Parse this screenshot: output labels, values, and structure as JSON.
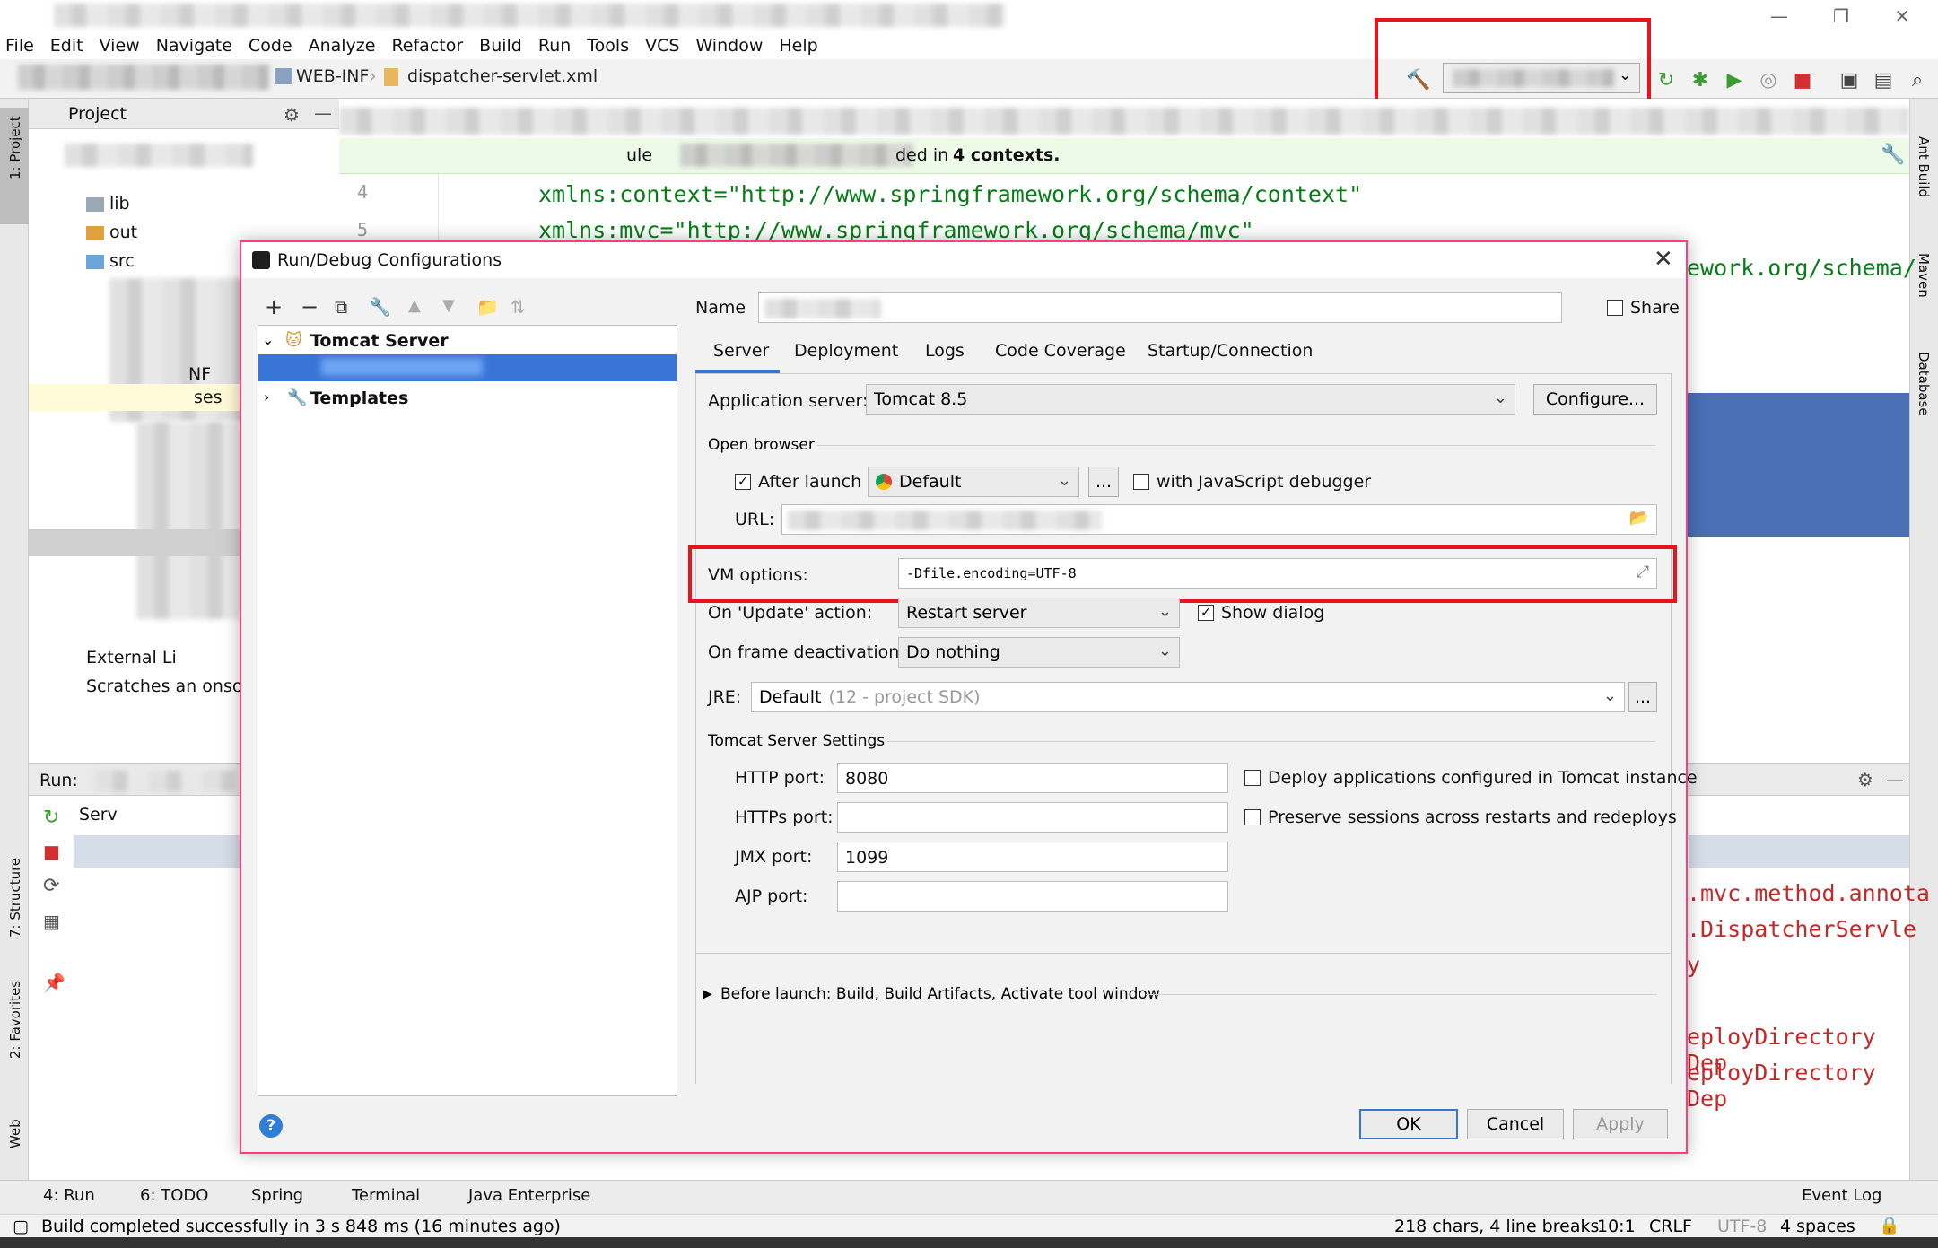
{
  "menu": [
    "File",
    "Edit",
    "View",
    "Navigate",
    "Code",
    "Analyze",
    "Refactor",
    "Build",
    "Run",
    "Tools",
    "VCS",
    "Window",
    "Help"
  ],
  "breadcrumb": {
    "folder": "WEB-INF",
    "file": "dispatcher-servlet.xml"
  },
  "project": {
    "header": "Project",
    "tree": [
      "lib",
      "out",
      "src",
      "NF",
      "ses",
      "External Li",
      "Scratches an onso"
    ]
  },
  "editor": {
    "banner_suffix": "ded in",
    "banner_bold": "4 contexts.",
    "banner_prefix": "ule",
    "line4_num": "4",
    "line5_num": "5",
    "line4": "xmlns:context=\"http://www.springframework.org/schema/context\"",
    "line5": "xmlns:mvc=\"http://www.springframework.org/schema/mvc\"",
    "line6_tail": "ework.org/schema/",
    "right_lines": [
      ".mvc.method.annota",
      ".DispatcherServle",
      "y",
      "eployDirectory Dep",
      "eployDirectory Dep"
    ]
  },
  "run_panel": {
    "label": "Run:",
    "item": "Serv"
  },
  "left_strip": [
    "1: Project",
    "7: Structure",
    "2: Favorites",
    "Web"
  ],
  "right_strip": [
    "Ant Build",
    "Maven",
    "Database"
  ],
  "bottom_tabs": [
    "4: Run",
    "6: TODO",
    "Spring",
    "Terminal",
    "Java Enterprise",
    "Event Log"
  ],
  "status": {
    "message": "Build completed successfully in 3 s 848 ms (16 minutes ago)",
    "chars": "218 chars, 4 line breaks",
    "pos": "10:1",
    "line_sep": "CRLF",
    "encoding": "UTF-8",
    "indent": "4 spaces"
  },
  "dialog": {
    "title": "Run/Debug Configurations",
    "tree_root": "Tomcat Server",
    "tree_templates": "Templates",
    "name_label": "Name",
    "name_value": "",
    "share_label": "Share",
    "tabs": [
      "Server",
      "Deployment",
      "Logs",
      "Code Coverage",
      "Startup/Connection"
    ],
    "app_server_label": "Application server:",
    "app_server_value": "Tomcat 8.5",
    "configure_button": "Configure...",
    "open_browser_label": "Open browser",
    "after_launch_label": "After launch",
    "browser_value": "Default",
    "ellipsis": "...",
    "js_debugger_label": "with JavaScript debugger",
    "url_label": "URL:",
    "vm_options_label": "VM options:",
    "vm_options_value": "-Dfile.encoding=UTF-8",
    "on_update_label": "On 'Update' action:",
    "on_update_value": "Restart server",
    "show_dialog_label": "Show dialog",
    "on_frame_label": "On frame deactivation:",
    "on_frame_value": "Do nothing",
    "jre_label": "JRE:",
    "jre_value": "Default",
    "jre_hint": "(12 - project SDK)",
    "tomcat_settings_label": "Tomcat Server Settings",
    "http_port_label": "HTTP port:",
    "http_port_value": "8080",
    "https_port_label": "HTTPs port:",
    "https_port_value": "",
    "jmx_port_label": "JMX port:",
    "jmx_port_value": "1099",
    "ajp_port_label": "AJP port:",
    "ajp_port_value": "",
    "deploy_label": "Deploy applications configured in Tomcat instance",
    "preserve_label": "Preserve sessions across restarts and redeploys",
    "before_launch": "Before launch: Build, Build Artifacts, Activate tool window",
    "ok": "OK",
    "cancel": "Cancel",
    "apply": "Apply",
    "help_icon": "?"
  },
  "colors": {
    "accent": "#3875d7",
    "highlight": "#e8141b",
    "dialog_border": "#ff3d7f",
    "code_green": "#067d17",
    "code_blue": "#0000ff"
  }
}
